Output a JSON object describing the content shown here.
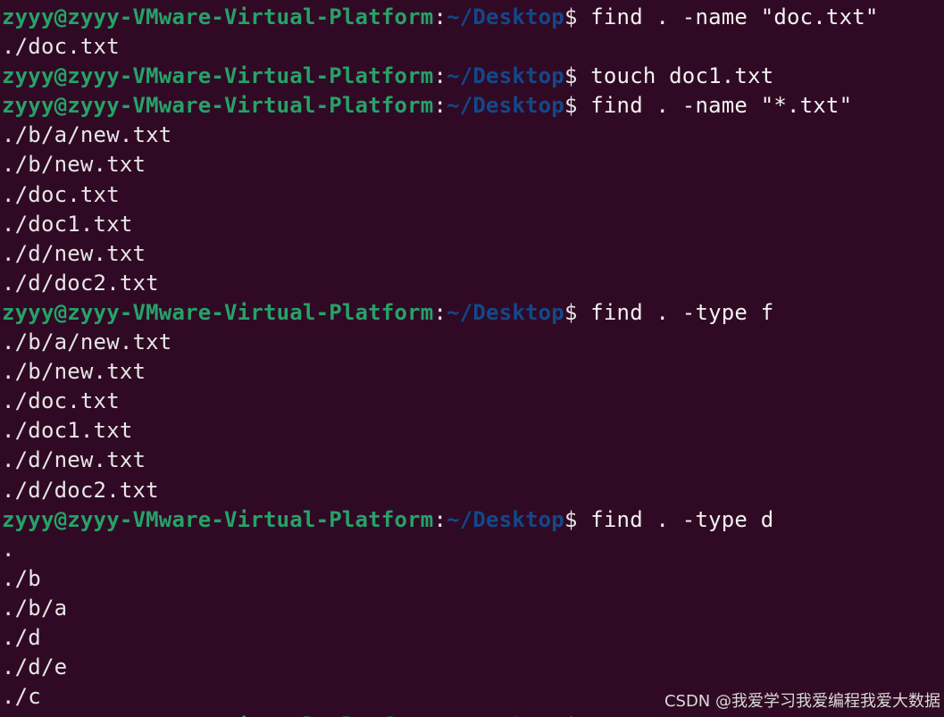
{
  "terminal": {
    "prompt": {
      "user_host": "zyyy@zyyy-VMware-Virtual-Platform",
      "colon": ":",
      "path": "~/Desktop",
      "symbol": "$ "
    },
    "lines": [
      {
        "type": "prompt",
        "command": "find . -name \"doc.txt\""
      },
      {
        "type": "output",
        "text": "./doc.txt"
      },
      {
        "type": "prompt",
        "command": "touch doc1.txt"
      },
      {
        "type": "prompt",
        "command": "find . -name \"*.txt\""
      },
      {
        "type": "output",
        "text": "./b/a/new.txt"
      },
      {
        "type": "output",
        "text": "./b/new.txt"
      },
      {
        "type": "output",
        "text": "./doc.txt"
      },
      {
        "type": "output",
        "text": "./doc1.txt"
      },
      {
        "type": "output",
        "text": "./d/new.txt"
      },
      {
        "type": "output",
        "text": "./d/doc2.txt"
      },
      {
        "type": "prompt",
        "command": "find . -type f"
      },
      {
        "type": "output",
        "text": "./b/a/new.txt"
      },
      {
        "type": "output",
        "text": "./b/new.txt"
      },
      {
        "type": "output",
        "text": "./doc.txt"
      },
      {
        "type": "output",
        "text": "./doc1.txt"
      },
      {
        "type": "output",
        "text": "./d/new.txt"
      },
      {
        "type": "output",
        "text": "./d/doc2.txt"
      },
      {
        "type": "prompt",
        "command": "find . -type d"
      },
      {
        "type": "output",
        "text": "."
      },
      {
        "type": "output",
        "text": "./b"
      },
      {
        "type": "output",
        "text": "./b/a"
      },
      {
        "type": "output",
        "text": "./d"
      },
      {
        "type": "output",
        "text": "./d/e"
      },
      {
        "type": "output",
        "text": "./c"
      },
      {
        "type": "prompt",
        "command": ""
      }
    ]
  },
  "watermark": "CSDN @我爱学习我爱编程我爱大数据",
  "colors": {
    "background": "#300a24",
    "user_host": "#26a269",
    "path": "#12488b",
    "text": "#e6e6e6"
  }
}
